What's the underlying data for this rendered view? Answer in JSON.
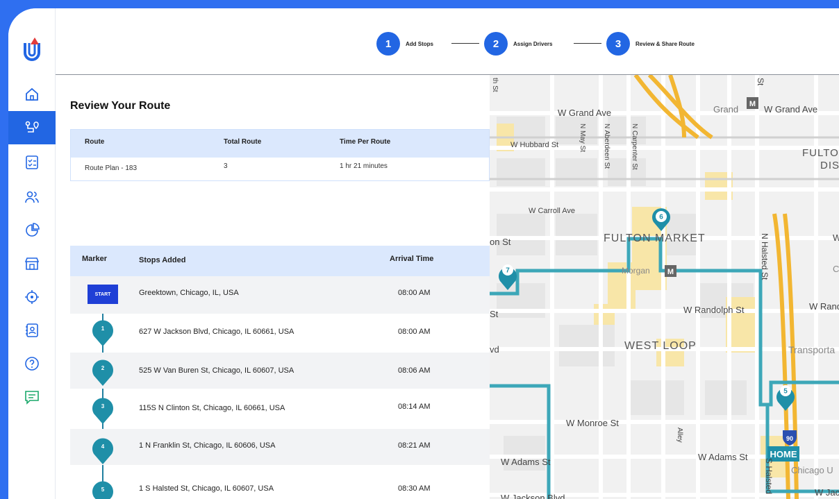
{
  "steps": [
    {
      "number": "1",
      "label": "Add Stops"
    },
    {
      "number": "2",
      "label": "Assign Drivers"
    },
    {
      "number": "3",
      "label": "Review & Share Route"
    }
  ],
  "page_title": "Review Your Route",
  "summary": {
    "headers": [
      "Route",
      "Total Route",
      "Time Per Route"
    ],
    "row": [
      "Route Plan - 183",
      "3",
      "1 hr 21 minutes"
    ]
  },
  "stops_table": {
    "headers": [
      "Marker",
      "Stops Added",
      "Arrival Time"
    ],
    "start_label": "START",
    "rows": [
      {
        "marker": "START",
        "address": "Greektown, Chicago, IL, USA",
        "time": "08:00 AM"
      },
      {
        "marker": "1",
        "address": "627 W Jackson Blvd, Chicago, IL 60661, USA",
        "time": "08:00 AM"
      },
      {
        "marker": "2",
        "address": "525 W Van Buren St, Chicago, IL 60607, USA",
        "time": "08:06 AM"
      },
      {
        "marker": "3",
        "address": "115S N Clinton St, Chicago, IL 60661, USA",
        "time": "08:14 AM"
      },
      {
        "marker": "4",
        "address": "1 N Franklin St, Chicago, IL 60606, USA",
        "time": "08:21 AM"
      },
      {
        "marker": "5",
        "address": "1 S Halsted St, Chicago, IL 60607, USA",
        "time": "08:30 AM"
      }
    ]
  },
  "map": {
    "streets": [
      "W Grand Ave",
      "Grand",
      "W Grand Ave",
      "W Hubbard St",
      "N May St",
      "N Aberdeen St",
      "N Carpenter St",
      "W Carroll Ave",
      "FULTON MARKET",
      "N Halsted St",
      "Morgan",
      "W Randolph St",
      "W Rand",
      "WEST LOOP",
      "Transporta",
      "W Monroe St",
      "Alley",
      "W Adams St",
      "W Adams St",
      "W Jackson Blvd",
      "W Jac",
      "S Halsted",
      "Chicago U",
      "FULTO",
      "DIST",
      "W",
      "C",
      "on St",
      "St",
      "vd",
      "th St",
      "St"
    ],
    "markers": [
      "6",
      "7",
      "5"
    ],
    "home_label": "HOME",
    "highway_shield": "90",
    "route_color": "#3da7b8"
  },
  "colors": {
    "accent": "#2266e3",
    "header_bg": "#dbe8fd",
    "marker": "#1f8fa8"
  }
}
